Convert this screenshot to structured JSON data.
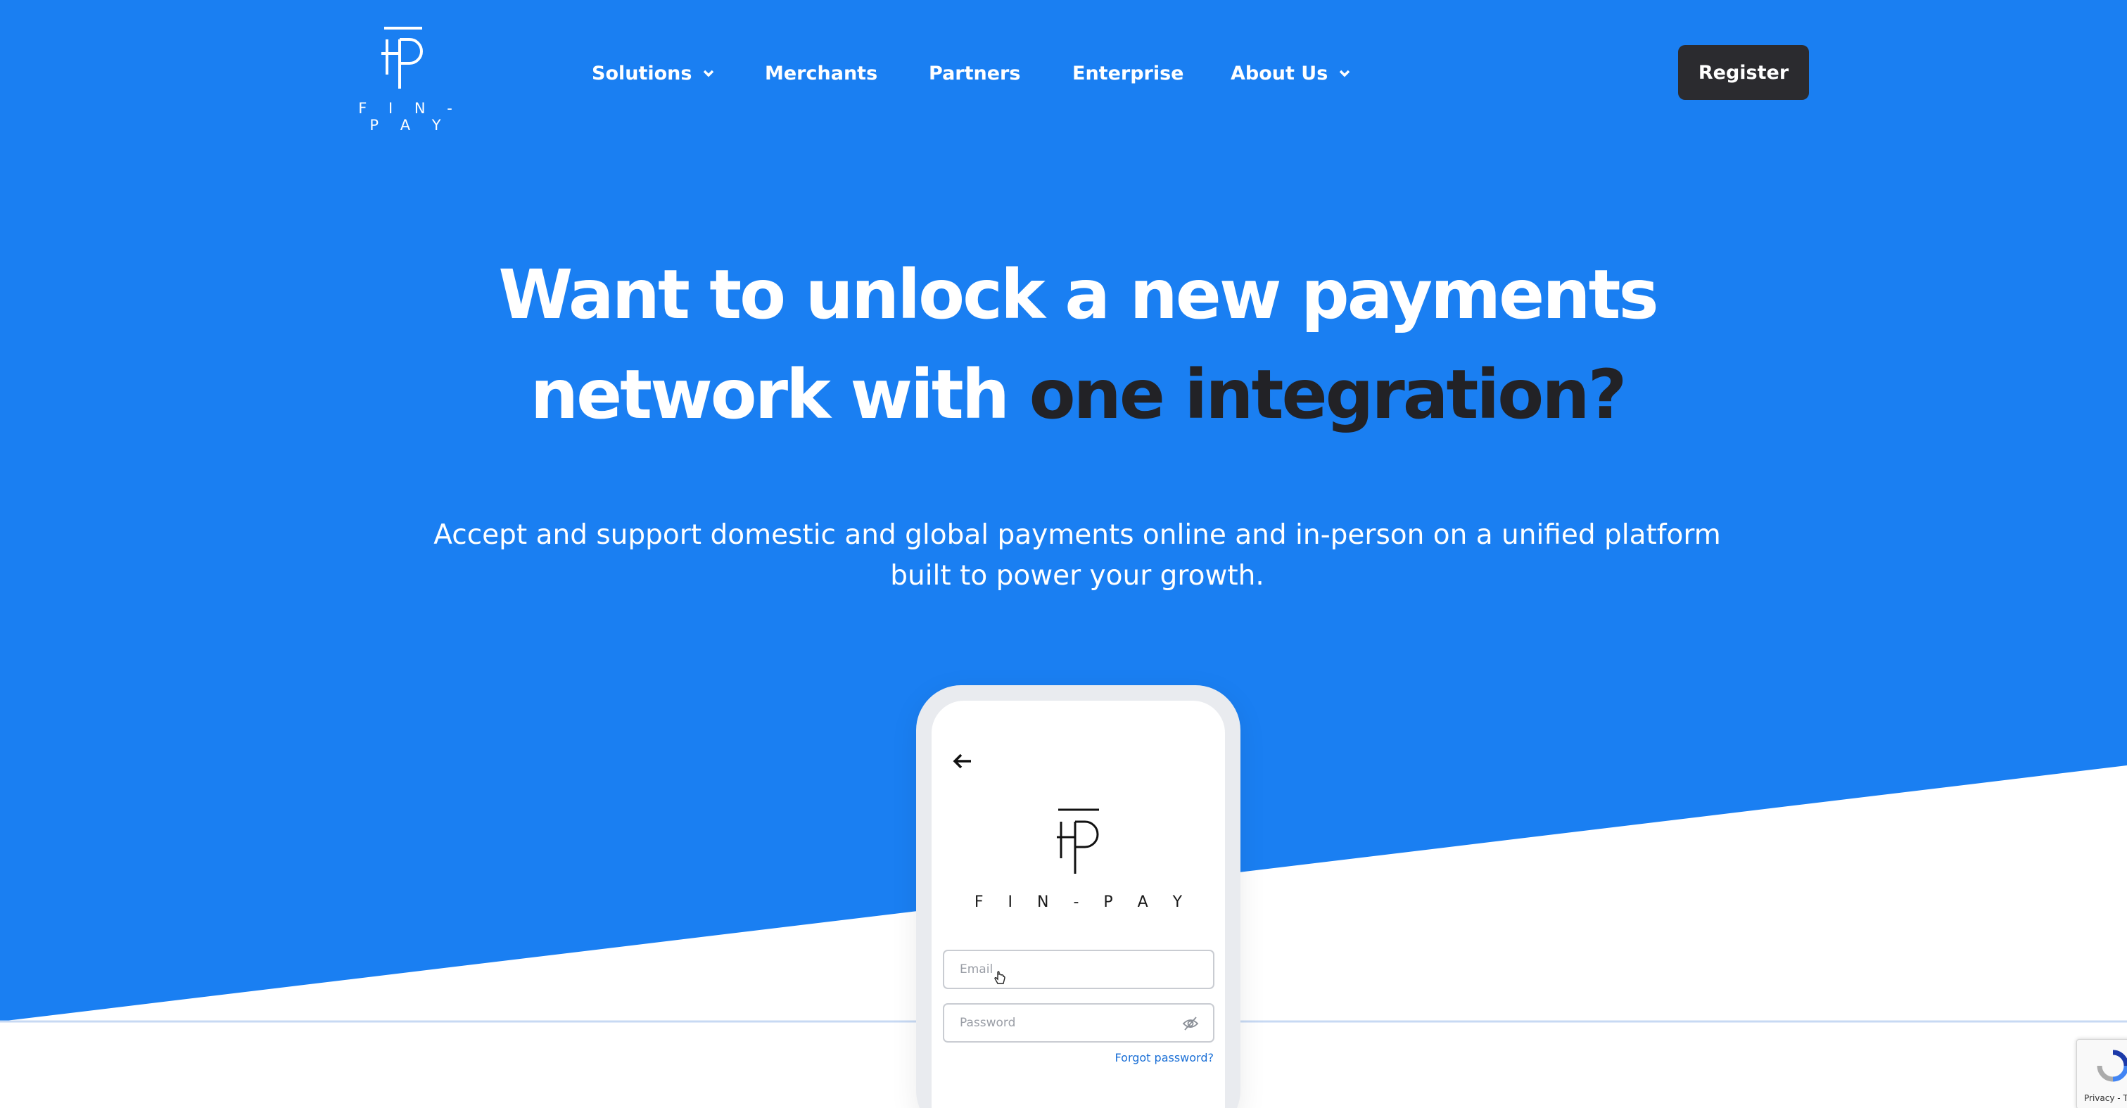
{
  "brand": {
    "name": "FIN-PAY",
    "logo_text": "F I N - P A Y"
  },
  "nav": {
    "items": [
      {
        "label": "Solutions",
        "has_dropdown": true
      },
      {
        "label": "Merchants",
        "has_dropdown": false
      },
      {
        "label": "Partners",
        "has_dropdown": false
      },
      {
        "label": "Enterprise",
        "has_dropdown": false
      },
      {
        "label": "About Us",
        "has_dropdown": true
      }
    ],
    "register_label": "Register"
  },
  "hero": {
    "headline_line1": "Want to unlock a new payments",
    "headline_line2_part1": "network with ",
    "headline_line2_highlight": "one integration?",
    "subtext_line1": "Accept and support domestic and global payments online and in-person on a unified platform",
    "subtext_line2": "built to power your growth."
  },
  "phone": {
    "logo_text": "F I N - P A Y",
    "email_placeholder": "Email",
    "password_placeholder": "Password",
    "forgot_label": "Forgot password?"
  },
  "recaptcha": {
    "label": "Privacy - T"
  },
  "colors": {
    "primary": "#1a7ff2",
    "dark": "#222226",
    "button": "#2b2b2f"
  },
  "icons": [
    "fp-logo-icon",
    "chevron-down-icon",
    "back-arrow-icon",
    "eye-slash-icon",
    "hand-cursor-icon",
    "recaptcha-icon"
  ]
}
